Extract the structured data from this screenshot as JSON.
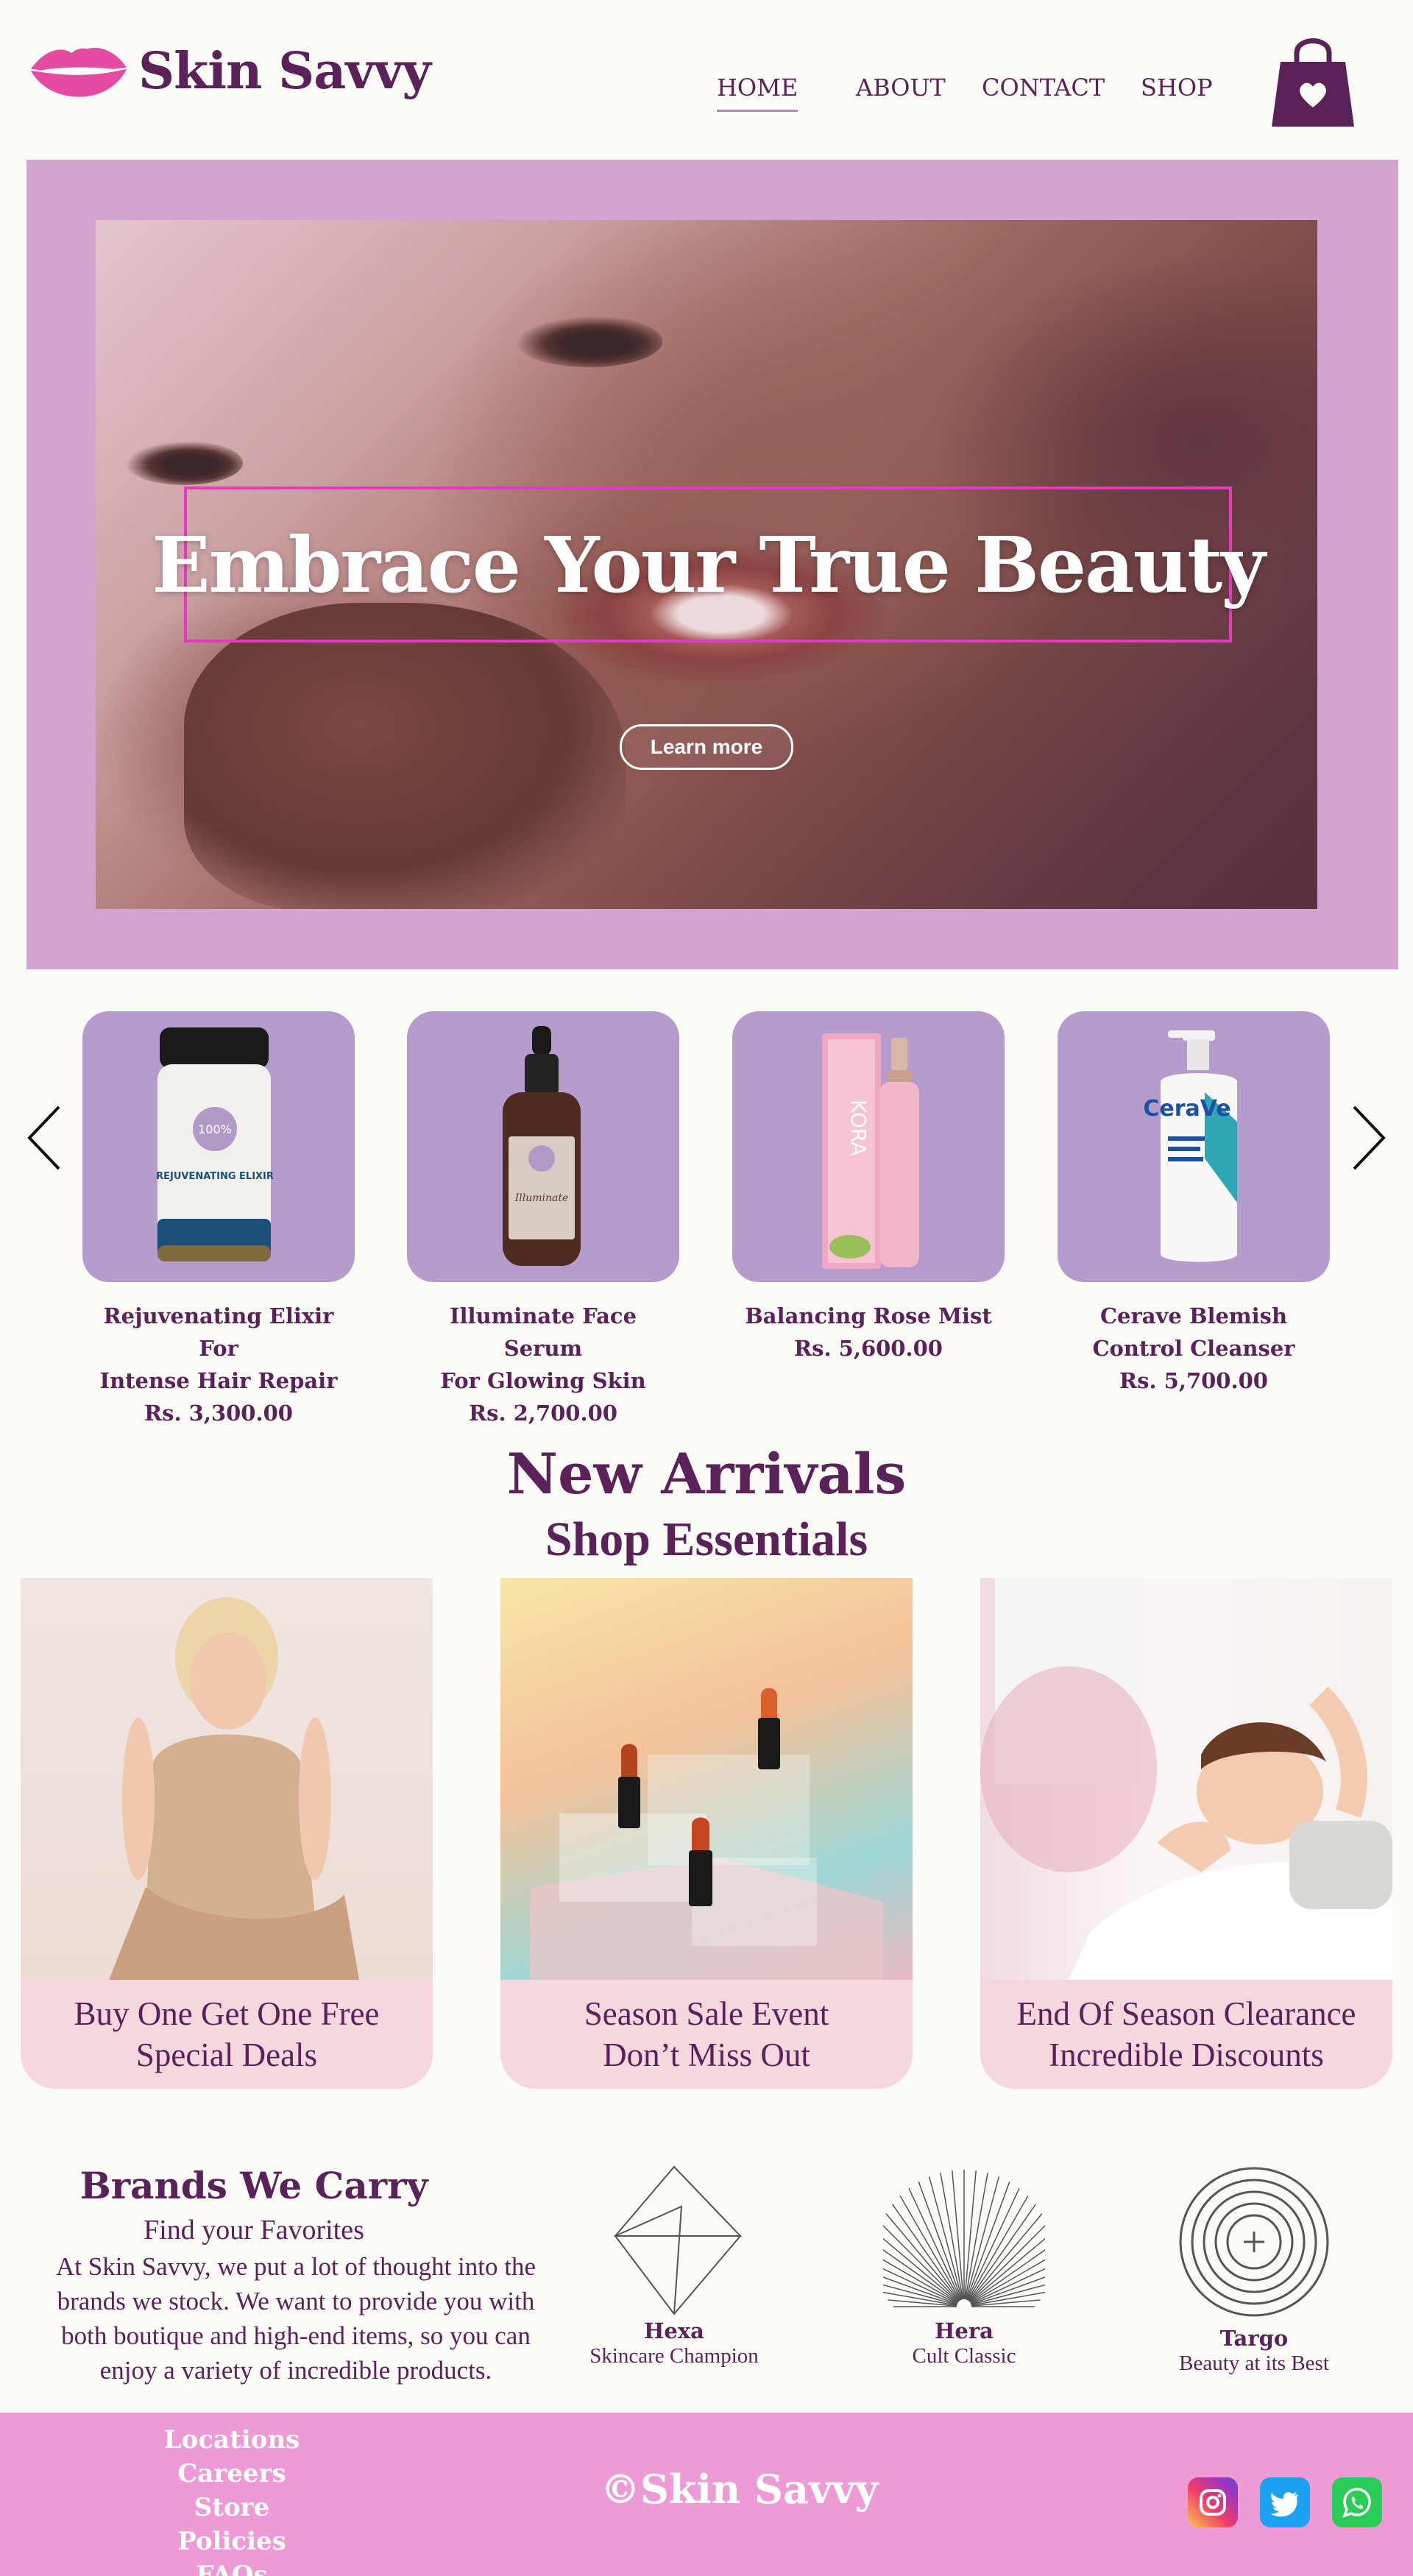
{
  "brand": {
    "name": "Skin Savvy"
  },
  "nav": [
    {
      "label": "HOME",
      "active": true
    },
    {
      "label": "ABOUT",
      "active": false
    },
    {
      "label": "CONTACT",
      "active": false
    },
    {
      "label": "SHOP",
      "active": false
    }
  ],
  "hero": {
    "title": "Embrace Your True Beauty",
    "button_label": "Learn more"
  },
  "carousel": {
    "products": [
      {
        "name_line1": "Rejuvenating Elixir For",
        "name_line2": "Intense Hair Repair",
        "price": "Rs. 3,300.00",
        "label_text": "REJUVENATING ELIXIR"
      },
      {
        "name_line1": "Illuminate Face Serum",
        "name_line2": "For Glowing Skin",
        "price": "Rs. 2,700.00",
        "label_text": "Illuminate"
      },
      {
        "name_line1": "Balancing Rose Mist",
        "name_line2": "",
        "price": "Rs. 5,600.00",
        "label_text": "KORA"
      },
      {
        "name_line1": "Cerave Blemish",
        "name_line2": "Control Cleanser",
        "price": "Rs. 5,700.00",
        "label_text": "CeraVe"
      }
    ]
  },
  "new_arrivals": {
    "title": "New Arrivals",
    "subtitle": "Shop Essentials",
    "promos": [
      {
        "line1": "Buy One Get One Free",
        "line2": "Special Deals"
      },
      {
        "line1": "Season Sale Event",
        "line2": "Don’t Miss Out"
      },
      {
        "line1": "End Of  Season Clearance",
        "line2": "Incredible Discounts"
      }
    ]
  },
  "brands": {
    "title": "Brands We Carry",
    "subtitle": "Find your Favorites",
    "description": [
      "At Skin Savvy, we put a lot of thought into the",
      "brands we stock. We want to provide you with",
      "both boutique and high-end items, so you can",
      "enjoy a variety of incredible products."
    ],
    "items": [
      {
        "name": "Hexa",
        "tagline": "Skincare Champion"
      },
      {
        "name": "Hera",
        "tagline": "Cult Classic"
      },
      {
        "name": "Targo",
        "tagline": "Beauty at its Best"
      }
    ]
  },
  "footer": {
    "links": [
      "Locations",
      "Careers",
      "Store Policies",
      "FAQs"
    ],
    "copyright": "©Skin Savvy",
    "social": [
      "instagram-icon",
      "twitter-icon",
      "whatsapp-icon"
    ]
  },
  "colors": {
    "primary": "#5a2258",
    "hero_bg": "#d3a4cf",
    "product_card": "#b59ccc",
    "promo_caption": "#f5d7de",
    "footer": "#ee9bd5",
    "accent_pink": "#e23ac0"
  }
}
